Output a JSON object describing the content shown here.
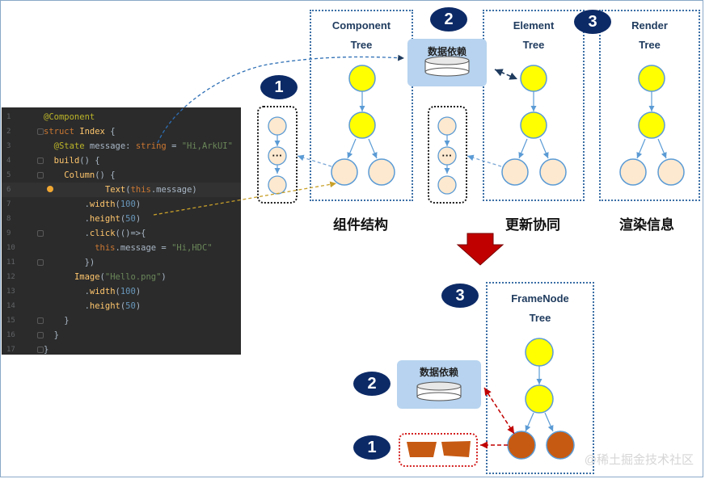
{
  "code_lines": [
    {
      "n": "1",
      "html": "<span class=\"an\">@Component</span>"
    },
    {
      "n": "2",
      "html": "<span class=\"kw\">struct</span> <span class=\"fn\">Index</span> {"
    },
    {
      "n": "3",
      "html": "  <span class=\"an\">@State</span> message: <span class=\"kw\">string</span> = <span class=\"str\">\"Hi,ArkUI\"</span>"
    },
    {
      "n": "4",
      "html": "  <span class=\"fn\">build</span>() {"
    },
    {
      "n": "5",
      "html": "    <span class=\"fn\">Column</span>() {"
    },
    {
      "n": "6",
      "html": "      <span class=\"fn\">Text</span>(<span class=\"kw\">this</span>.message)"
    },
    {
      "n": "7",
      "html": "        .<span class=\"fn\">width</span>(<span class=\"num\">100</span>)"
    },
    {
      "n": "8",
      "html": "        .<span class=\"fn\">height</span>(<span class=\"num\">50</span>)"
    },
    {
      "n": "9",
      "html": "        .<span class=\"fn\">click</span>(()=>{"
    },
    {
      "n": "10",
      "html": "          <span class=\"kw\">this</span>.message = <span class=\"str\">\"Hi,HDC\"</span>"
    },
    {
      "n": "11",
      "html": "        })"
    },
    {
      "n": "12",
      "html": "      <span class=\"fn\">Image</span>(<span class=\"str\">\"Hello.png\"</span>)"
    },
    {
      "n": "13",
      "html": "        .<span class=\"fn\">width</span>(<span class=\"num\">100</span>)"
    },
    {
      "n": "14",
      "html": "        .<span class=\"fn\">height</span>(<span class=\"num\">50</span>)"
    },
    {
      "n": "15",
      "html": "    }"
    },
    {
      "n": "16",
      "html": "  }"
    },
    {
      "n": "17",
      "html": "}"
    }
  ],
  "top": {
    "component_title_1": "Component",
    "component_title_2": "Tree",
    "element_title_1": "Element",
    "element_title_2": "Tree",
    "render_title_1": "Render",
    "render_title_2": "Tree",
    "data_dep": "数据依赖",
    "caption_component": "组件结构",
    "caption_element": "更新协同",
    "caption_render": "渲染信息",
    "badge_1": "1",
    "badge_2": "2",
    "badge_3": "3",
    "ellipsis": "···"
  },
  "bottom": {
    "framenode_title_1": "FrameNode",
    "framenode_title_2": "Tree",
    "data_dep": "数据依赖",
    "badge_1": "1",
    "badge_2": "2",
    "badge_3": "3"
  },
  "watermark": "@稀土掘金技术社区",
  "colors": {
    "node_yellow": "#ffff00",
    "node_peach": "#fde9d0",
    "node_orange": "#c75a12",
    "navy": "#0c2a66",
    "dep_blue": "#b7d3ef",
    "arrow_red": "#c00000"
  }
}
